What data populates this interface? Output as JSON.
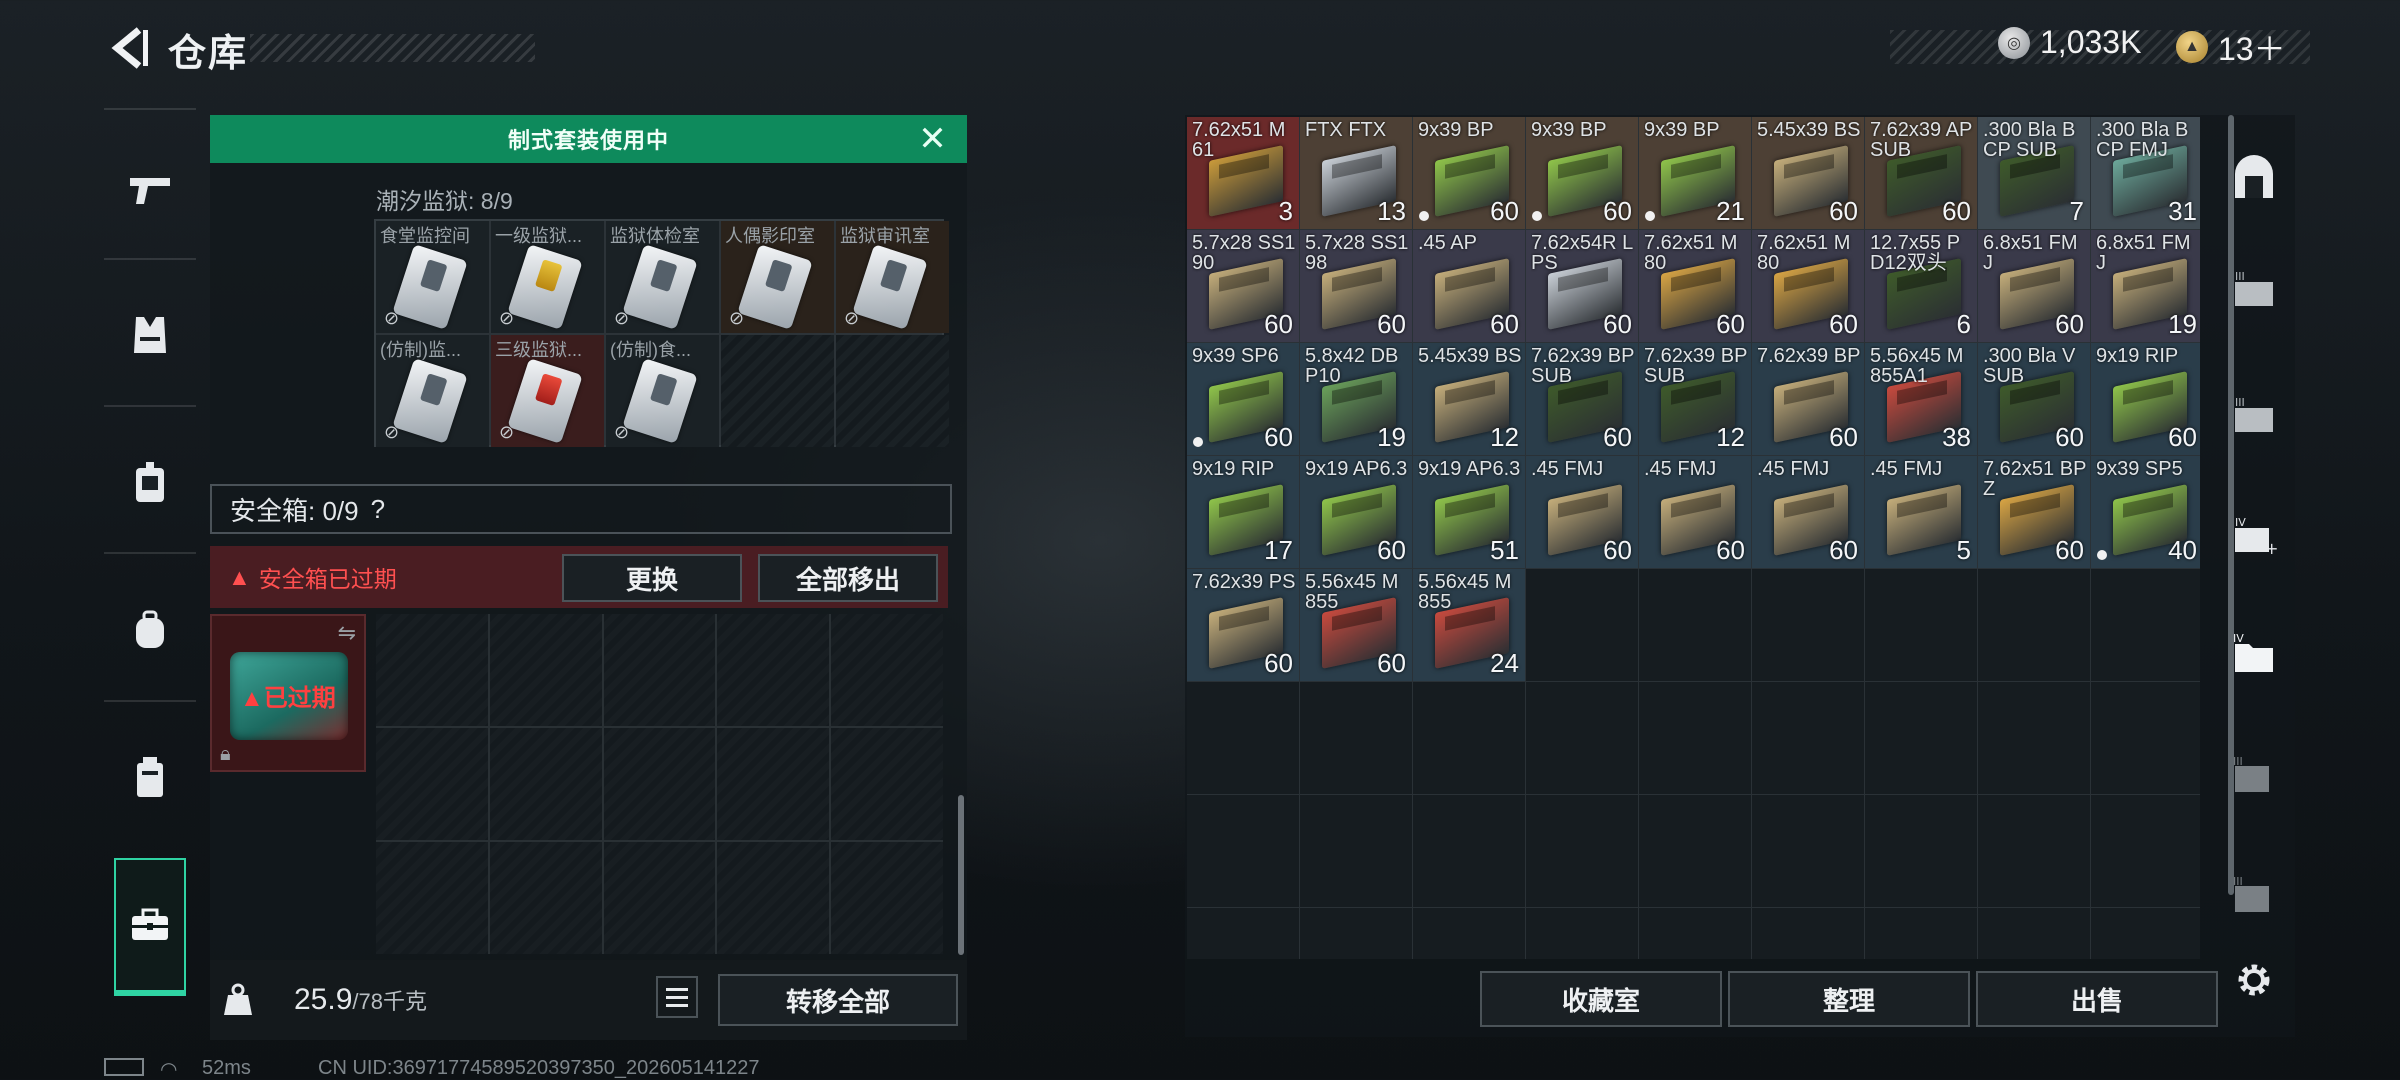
{
  "header": {
    "title": "仓库",
    "currency_amount": "1,033K",
    "tokens": "13＋"
  },
  "loadout": {
    "banner": "制式套装使用中",
    "prison_title": "潮汐监狱: 8/9",
    "prison_keys": [
      {
        "label": "食堂监控间",
        "style": "white"
      },
      {
        "label": "一级监狱...",
        "style": "yellow"
      },
      {
        "label": "监狱体检室",
        "style": "white"
      },
      {
        "label": "人偶影印室",
        "style": "white"
      },
      {
        "label": "监狱审讯室",
        "style": "white"
      },
      {
        "label": "(仿制)监...",
        "style": "white"
      },
      {
        "label": "三级监狱...",
        "style": "red"
      },
      {
        "label": "(仿制)食...",
        "style": "white"
      },
      {
        "label": "",
        "style": "empty"
      },
      {
        "label": "",
        "style": "empty"
      }
    ],
    "safe_label": "安全箱: 0/9",
    "safe_help": "?",
    "expired_warning": "安全箱已过期",
    "replace_btn": "更换",
    "remove_all_btn": "全部移出",
    "safebox_status": "已过期",
    "weight_value": "25.9",
    "weight_unit": "/78千克",
    "transfer_all_btn": "转移全部"
  },
  "warehouse": {
    "items": [
      {
        "name": "7.62x51 M61",
        "qty": "3",
        "bg": "#6b2a2a",
        "box": "#c99a3a"
      },
      {
        "name": "FTX FTX",
        "qty": "13",
        "bg": "#4d4035",
        "box": "#c9cfd6"
      },
      {
        "name": "9x39 BP",
        "qty": "60",
        "bg": "#4d4035",
        "box": "#8fc44a",
        "dot": true
      },
      {
        "name": "9x39 BP",
        "qty": "60",
        "bg": "#4d4035",
        "box": "#8fc44a",
        "dot": true
      },
      {
        "name": "9x39 BP",
        "qty": "21",
        "bg": "#4d4035",
        "box": "#8fc44a",
        "dot": true
      },
      {
        "name": "5.45x39 BS",
        "qty": "60",
        "bg": "#4d4035",
        "box": "#c4ad7a"
      },
      {
        "name": "7.62x39 AP SUB",
        "qty": "60",
        "bg": "#4d4035",
        "box": "#3e5a2a"
      },
      {
        "name": ".300 Bla BCP SUB",
        "qty": "7",
        "bg": "#3f4a52",
        "box": "#3e5a2a"
      },
      {
        "name": ".300 Bla BCP FMJ",
        "qty": "31",
        "bg": "#3f4a52",
        "box": "#6ca89a"
      },
      {
        "name": "5.7x28 SS190",
        "qty": "60",
        "bg": "#3a3a4a",
        "box": "#c4ad7a"
      },
      {
        "name": "5.7x28 SS198",
        "qty": "60",
        "bg": "#3a3a4a",
        "box": "#c4ad7a"
      },
      {
        "name": ".45 AP",
        "qty": "60",
        "bg": "#3a3a4a",
        "box": "#c4ad7a"
      },
      {
        "name": "7.62x54R LPS",
        "qty": "60",
        "bg": "#3a3a4a",
        "box": "#c9cfd6"
      },
      {
        "name": "7.62x51 M80",
        "qty": "60",
        "bg": "#3a3a4a",
        "box": "#d8a444"
      },
      {
        "name": "7.62x51 M80",
        "qty": "60",
        "bg": "#3a3a4a",
        "box": "#d8a444"
      },
      {
        "name": "12.7x55 PD12双头",
        "qty": "6",
        "bg": "#3a3a4a",
        "box": "#3e5a2a"
      },
      {
        "name": "6.8x51 FMJ",
        "qty": "60",
        "bg": "#3a3a4a",
        "box": "#c4ad7a"
      },
      {
        "name": "6.8x51 FMJ",
        "qty": "19",
        "bg": "#3a3a4a",
        "box": "#c4ad7a"
      },
      {
        "name": "9x39 SP6",
        "qty": "60",
        "bg": "#2a3d4a",
        "box": "#8fc44a",
        "dot": true
      },
      {
        "name": "5.8x42 DBP10",
        "qty": "19",
        "bg": "#2a3d4a",
        "box": "#6aa05a"
      },
      {
        "name": "5.45x39 BS",
        "qty": "12",
        "bg": "#2a3d4a",
        "box": "#c4ad7a"
      },
      {
        "name": "7.62x39 BP SUB",
        "qty": "60",
        "bg": "#2a3d4a",
        "box": "#3e5a2a"
      },
      {
        "name": "7.62x39 BP SUB",
        "qty": "12",
        "bg": "#2a3d4a",
        "box": "#3e5a2a"
      },
      {
        "name": "7.62x39 BP",
        "qty": "60",
        "bg": "#2a3d4a",
        "box": "#c4ad7a"
      },
      {
        "name": "5.56x45 M855A1",
        "qty": "38",
        "bg": "#2a3d4a",
        "box": "#c84a3e"
      },
      {
        "name": ".300 Bla V SUB",
        "qty": "60",
        "bg": "#2a3d4a",
        "box": "#3e5a2a"
      },
      {
        "name": "9x19 RIP",
        "qty": "60",
        "bg": "#2a3d4a",
        "box": "#8fc44a"
      },
      {
        "name": "9x19 RIP",
        "qty": "17",
        "bg": "#2a3d4a",
        "box": "#8fc44a"
      },
      {
        "name": "9x19 AP6.3",
        "qty": "60",
        "bg": "#2a3d4a",
        "box": "#8fc44a"
      },
      {
        "name": "9x19 AP6.3",
        "qty": "51",
        "bg": "#2a3d4a",
        "box": "#8fc44a"
      },
      {
        "name": ".45 FMJ",
        "qty": "60",
        "bg": "#2a3d4a",
        "box": "#c4ad7a"
      },
      {
        "name": ".45 FMJ",
        "qty": "60",
        "bg": "#2a3d4a",
        "box": "#c4ad7a"
      },
      {
        "name": ".45 FMJ",
        "qty": "60",
        "bg": "#2a3d4a",
        "box": "#c4ad7a"
      },
      {
        "name": ".45 FMJ",
        "qty": "5",
        "bg": "#2a3d4a",
        "box": "#c4ad7a"
      },
      {
        "name": "7.62x51 BPZ",
        "qty": "60",
        "bg": "#2a3d4a",
        "box": "#d8a444"
      },
      {
        "name": "9x39 SP5",
        "qty": "40",
        "bg": "#2a3d4a",
        "box": "#8fc44a",
        "dot": true
      },
      {
        "name": "7.62x39 PS",
        "qty": "60",
        "bg": "#2a3d4a",
        "box": "#c4ad7a"
      },
      {
        "name": "5.56x45 M855",
        "qty": "60",
        "bg": "#2a3d4a",
        "box": "#c84a3e"
      },
      {
        "name": "5.56x45 M855",
        "qty": "24",
        "bg": "#2a3d4a",
        "box": "#c84a3e"
      }
    ],
    "collect_btn": "收藏室",
    "sort_btn": "整理",
    "sell_btn": "出售"
  },
  "status": {
    "ping": "52ms",
    "uid": "CN UID:36971774589520397350_202605141227"
  }
}
